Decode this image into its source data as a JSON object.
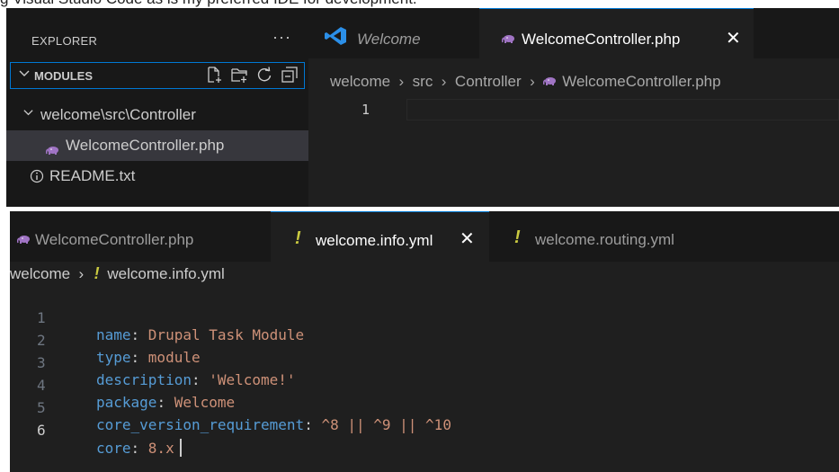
{
  "caption": {
    "text": "g Visual Studio Code as is my preferred IDE for development."
  },
  "explorer": {
    "title": "EXPLORER",
    "more": "···",
    "section": "MODULES",
    "folder": "welcome\\src\\Controller",
    "files": [
      "WelcomeController.php",
      "README.txt"
    ]
  },
  "editor1": {
    "tabs": [
      "Welcome",
      "WelcomeController.php"
    ],
    "close": "✕",
    "breadcrumb": [
      "welcome",
      "src",
      "Controller",
      "WelcomeController.php"
    ],
    "line_number": "1"
  },
  "editor2": {
    "tabs": [
      "WelcomeController.php",
      "welcome.info.yml",
      "welcome.routing.yml"
    ],
    "close": "✕",
    "breadcrumb": [
      "welcome",
      "welcome.info.yml"
    ],
    "lines": [
      {
        "n": "1",
        "key": "name",
        "value": "Drupal Task Module"
      },
      {
        "n": "2",
        "key": "type",
        "value": "module"
      },
      {
        "n": "3",
        "key": "description",
        "value": "'Welcome!'"
      },
      {
        "n": "4",
        "key": "package",
        "value": "Welcome"
      },
      {
        "n": "5",
        "key": "core_version_requirement",
        "value": "^8 || ^9 || ^10"
      },
      {
        "n": "6",
        "key": "core",
        "value": "8.x"
      }
    ]
  },
  "colors": {
    "bg_editor": "#1f1f1f",
    "bg_sidebar": "#181818",
    "accent": "#0078d4",
    "yaml_key": "#569cd6",
    "yaml_value": "#ce9178",
    "yaml_bang": "#cbcb41",
    "php_icon": "#a074c4"
  },
  "icons": [
    "new-file-icon",
    "new-folder-icon",
    "refresh-icon",
    "collapse-all-icon",
    "php-elephant-icon",
    "info-icon",
    "vscode-logo-icon",
    "yaml-exclamation-icon",
    "chevron-right-icon",
    "chevron-down-icon",
    "close-icon"
  ]
}
